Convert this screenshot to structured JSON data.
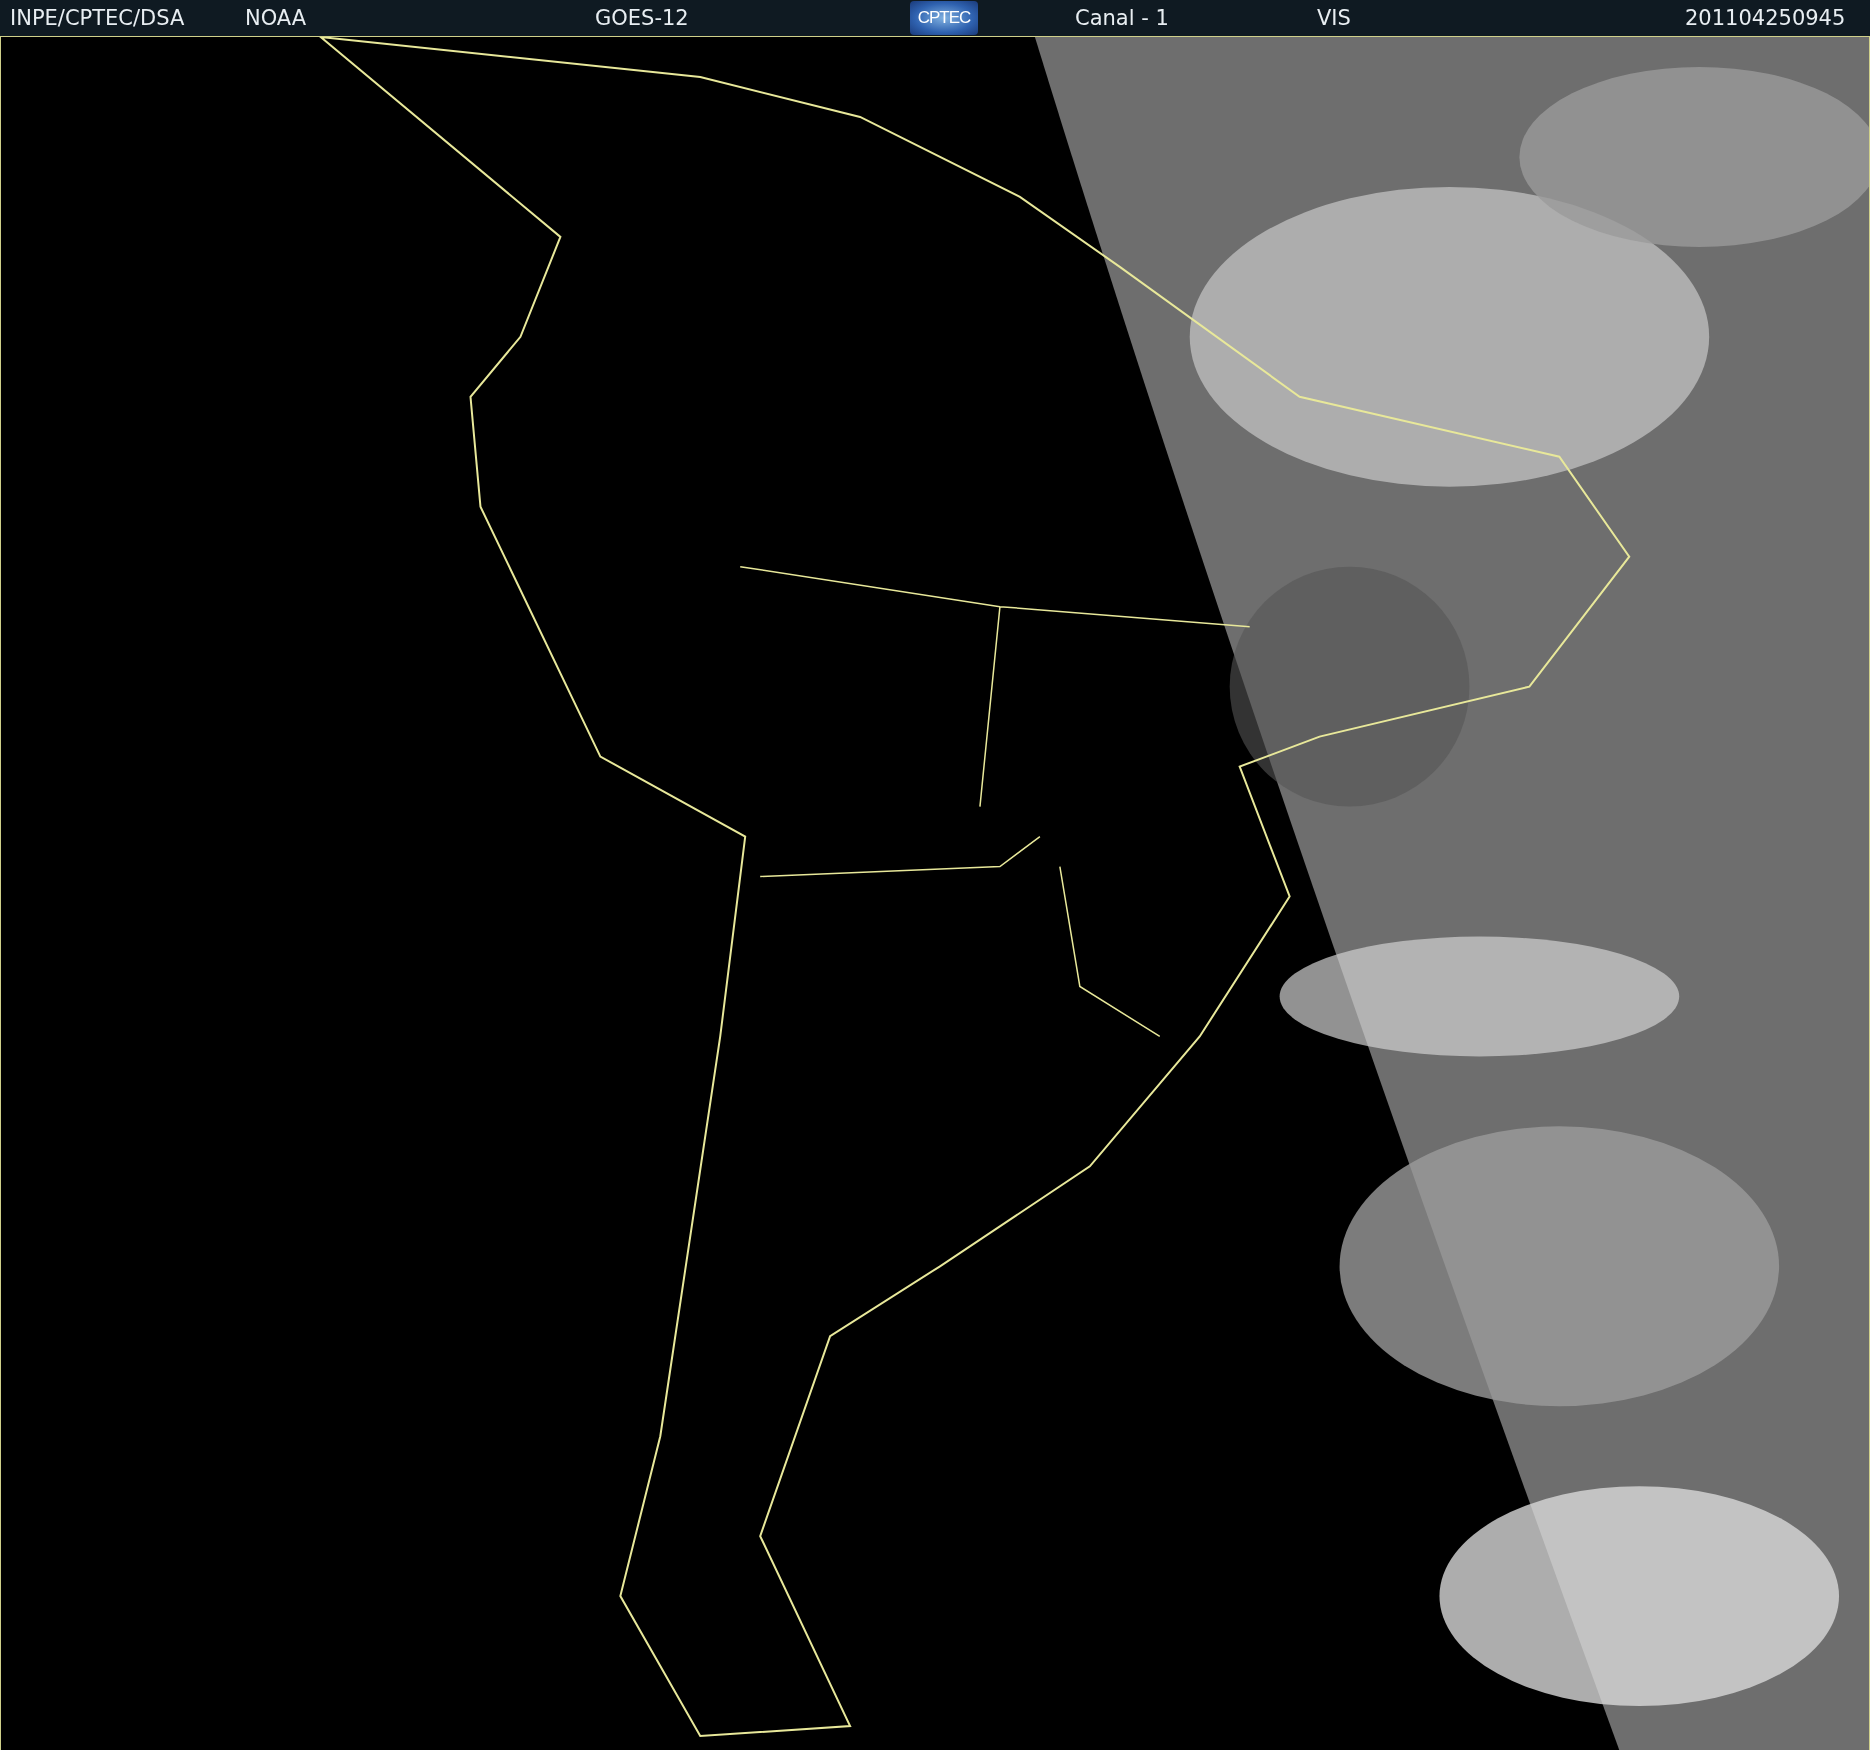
{
  "header": {
    "source": "INPE/CPTEC/DSA",
    "agency": "NOAA",
    "satellite": "GOES-12",
    "logo_text": "CPTEC",
    "channel": "Canal - 1",
    "band": "VIS",
    "timestamp": "201104250945"
  }
}
